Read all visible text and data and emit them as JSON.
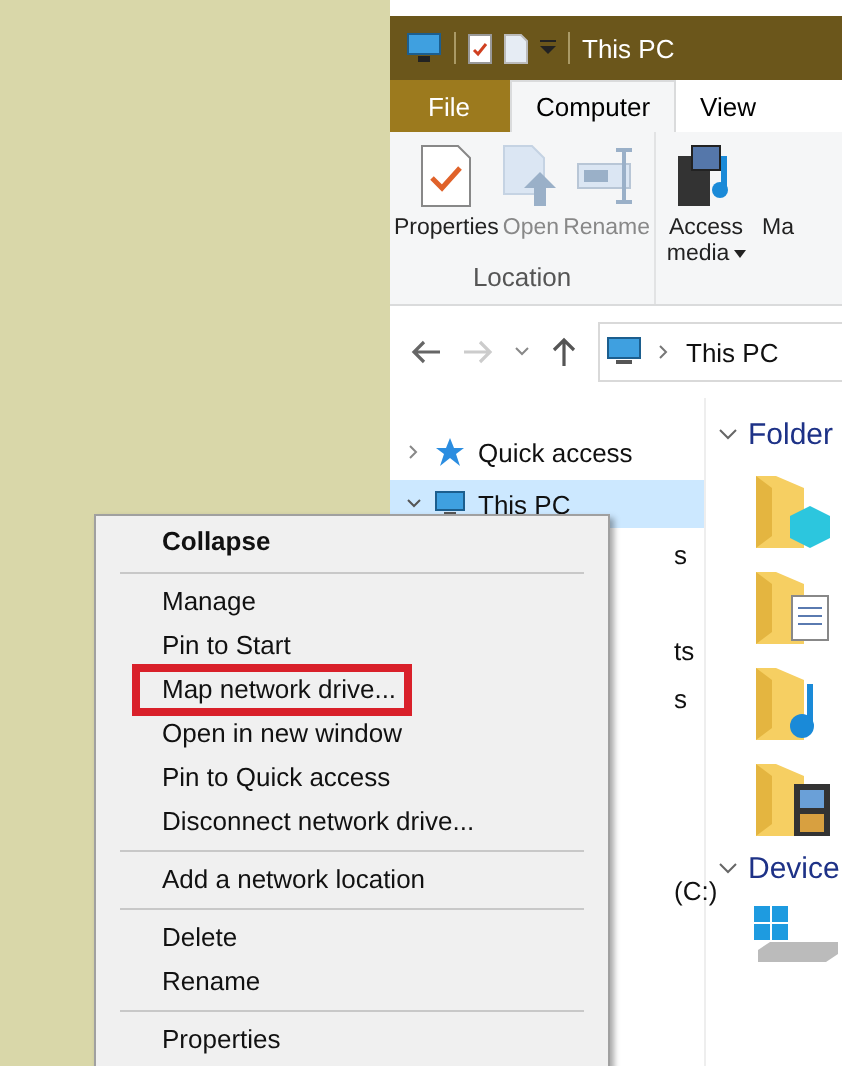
{
  "window": {
    "title": "This PC"
  },
  "ribbon_tabs": [
    {
      "label": "File",
      "kind": "file",
      "selected": false
    },
    {
      "label": "Computer",
      "kind": "tab",
      "selected": true
    },
    {
      "label": "View",
      "kind": "tab",
      "selected": false
    }
  ],
  "ribbon_groups": [
    {
      "label": "Location",
      "buttons": [
        {
          "label": "Properties",
          "kind": "properties",
          "disabled": false
        },
        {
          "label": "Open",
          "kind": "open",
          "disabled": true
        },
        {
          "label": "Rename",
          "kind": "rename",
          "disabled": true
        }
      ]
    },
    {
      "buttons": [
        {
          "label": "Access media",
          "kind": "media",
          "disabled": false,
          "dropdown": true
        },
        {
          "label": "Ma",
          "kind": "cut",
          "disabled": false
        }
      ]
    }
  ],
  "address_bar": {
    "path": "This PC"
  },
  "nav_pane": [
    {
      "label": "Quick access",
      "kind": "star",
      "expanded": false,
      "selected": false
    },
    {
      "label": "This PC",
      "kind": "pc",
      "expanded": true,
      "selected": true,
      "children": [
        {
          "label": "s"
        },
        {
          "label": "ts"
        },
        {
          "label": "s"
        },
        {
          "label": "(C:)"
        }
      ]
    }
  ],
  "content": {
    "sections": [
      {
        "title": "Folder",
        "folders": [
          {
            "kind": "cube"
          },
          {
            "kind": "doc"
          },
          {
            "kind": "music"
          },
          {
            "kind": "video"
          }
        ]
      },
      {
        "title": "Device",
        "folders": [
          {
            "kind": "drive"
          }
        ]
      }
    ]
  },
  "context_menu": [
    {
      "kind": "default",
      "label": "Collapse",
      "highlighted": false
    },
    {
      "kind": "separator"
    },
    {
      "kind": "item",
      "label": "Manage",
      "highlighted": false
    },
    {
      "kind": "item",
      "label": "Pin to Start",
      "highlighted": false
    },
    {
      "kind": "item",
      "label": "Map network drive...",
      "highlighted": true
    },
    {
      "kind": "item",
      "label": "Open in new window",
      "highlighted": false
    },
    {
      "kind": "item",
      "label": "Pin to Quick access",
      "highlighted": false
    },
    {
      "kind": "item",
      "label": "Disconnect network drive...",
      "highlighted": false
    },
    {
      "kind": "separator"
    },
    {
      "kind": "item",
      "label": "Add a network location",
      "highlighted": false
    },
    {
      "kind": "separator"
    },
    {
      "kind": "item",
      "label": "Delete",
      "highlighted": false
    },
    {
      "kind": "item",
      "label": "Rename",
      "highlighted": false
    },
    {
      "kind": "separator"
    },
    {
      "kind": "item",
      "label": "Properties",
      "highlighted": false
    }
  ]
}
